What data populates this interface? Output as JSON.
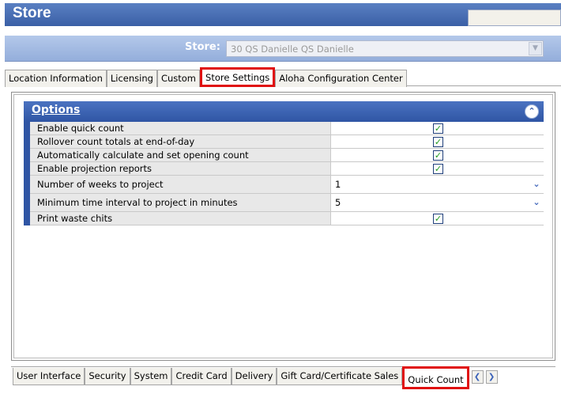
{
  "window": {
    "title": "Store"
  },
  "store": {
    "label": "Store:",
    "value": "30 QS Danielle QS Danielle"
  },
  "top_tabs": [
    {
      "label": "Location Information"
    },
    {
      "label": "Licensing"
    },
    {
      "label": "Custom"
    },
    {
      "label": "Store Settings",
      "active": true
    },
    {
      "label": "Aloha Configuration Center"
    }
  ],
  "options": {
    "title": "Options",
    "rows": [
      {
        "label": "Enable quick count",
        "type": "checkbox",
        "checked": true
      },
      {
        "label": "Rollover count totals at end-of-day",
        "type": "checkbox",
        "checked": true
      },
      {
        "label": "Automatically calculate and set opening count",
        "type": "checkbox",
        "checked": true
      },
      {
        "label": "Enable projection reports",
        "type": "checkbox",
        "checked": true
      },
      {
        "label": "Number of weeks to project",
        "type": "dropdown",
        "value": "1"
      },
      {
        "label": "Minimum time interval to project in minutes",
        "type": "dropdown",
        "value": "5"
      },
      {
        "label": "Print waste chits",
        "type": "checkbox",
        "checked": true
      }
    ]
  },
  "bottom_tabs": [
    {
      "label": "User Interface"
    },
    {
      "label": "Security"
    },
    {
      "label": "System"
    },
    {
      "label": "Credit Card"
    },
    {
      "label": "Delivery"
    },
    {
      "label": "Gift Card/Certificate Sales"
    },
    {
      "label": "Quick Count",
      "active": true
    }
  ],
  "colors": {
    "accent": "#3a5fa6",
    "highlight": "#e01010",
    "check": "#1e9a1e"
  }
}
